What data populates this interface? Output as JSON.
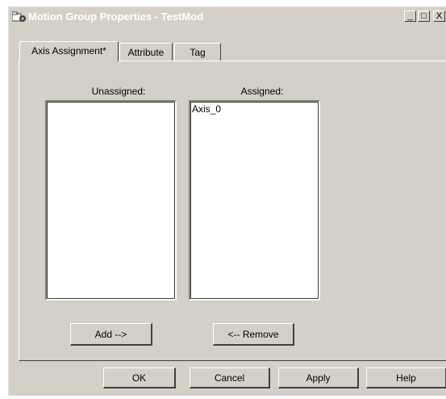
{
  "window": {
    "title": "Motion Group Properties - TestMod",
    "controls": {
      "minimize": "_",
      "maximize": "□",
      "close": "X"
    }
  },
  "tabs": [
    {
      "label": "Axis Assignment*",
      "active": true
    },
    {
      "label": "Attribute",
      "active": false
    },
    {
      "label": "Tag",
      "active": false
    }
  ],
  "axis_assignment": {
    "unassigned_label": "Unassigned:",
    "assigned_label": "Assigned:",
    "unassigned_items": [],
    "assigned_items": [
      "Axis_0"
    ],
    "add_button": "Add -->",
    "remove_button": "<-- Remove"
  },
  "footer": {
    "ok": "OK",
    "cancel": "Cancel",
    "apply": "Apply",
    "help": "Help"
  },
  "colors": {
    "face": "#d4d0c8",
    "title_text": "#ffffff",
    "list_bg": "#ffffff"
  },
  "icons": {
    "app": "motion-group-icon"
  }
}
